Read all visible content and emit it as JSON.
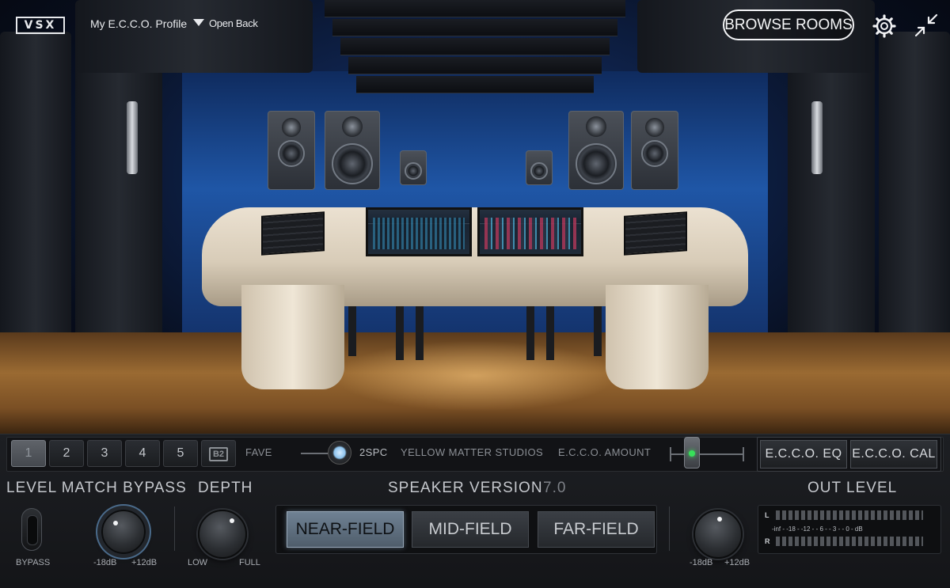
{
  "topbar": {
    "logo": "VSX",
    "profile": "My E.C.C.O. Profile",
    "mode": "Open Back",
    "browse_label": "BROWSE ROOMS"
  },
  "slots": [
    "1",
    "2",
    "3",
    "4",
    "5",
    "B2"
  ],
  "active_slot": "1",
  "strip": {
    "fave": "FAVE",
    "toggle_label": "2SPC",
    "studio": "YELLOW MATTER STUDIOS",
    "ecco_amount": "E.C.C.O. AMOUNT",
    "ecco_eq": "E.C.C.O.  EQ",
    "ecco_cal": "E.C.C.O.  CAL"
  },
  "level_match": {
    "title": "LEVEL MATCH BYPASS",
    "bypass": "BYPASS",
    "min": "-18dB",
    "max": "+12dB"
  },
  "depth": {
    "title": "DEPTH",
    "low": "LOW",
    "full": "FULL"
  },
  "speaker_version": {
    "title": "SPEAKER VERSION",
    "version": "7.0",
    "options": [
      "NEAR-FIELD",
      "MID-FIELD",
      "FAR-FIELD"
    ],
    "selected": "NEAR-FIELD"
  },
  "out_level": {
    "title": "OUT LEVEL",
    "min": "-18dB",
    "max": "+12dB",
    "meter_left": "L",
    "meter_right": "R",
    "meter_scale": "-inf - -18 - -12 - - 6 - - 3 - - 0 - dB"
  },
  "colors": {
    "accent_led": "#38e05a",
    "active_button": "#6f8193"
  }
}
